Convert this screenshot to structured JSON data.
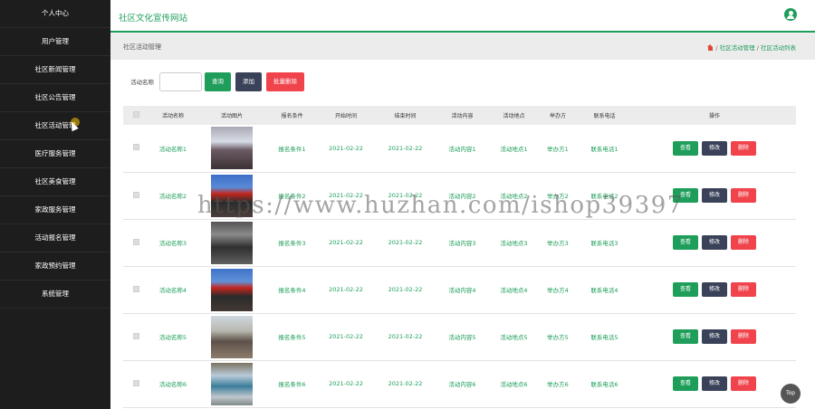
{
  "sidebar": {
    "items": [
      {
        "label": "个人中心"
      },
      {
        "label": "用户管理"
      },
      {
        "label": "社区新闻管理"
      },
      {
        "label": "社区公告管理"
      },
      {
        "label": "社区活动管理"
      },
      {
        "label": "医疗服务管理"
      },
      {
        "label": "社区美食管理"
      },
      {
        "label": "家政服务管理"
      },
      {
        "label": "活动报名管理"
      },
      {
        "label": "家政预约管理"
      },
      {
        "label": "系统管理"
      }
    ]
  },
  "header": {
    "title": "社区文化宣传网站",
    "avatar_icon": "user-icon"
  },
  "breadcrumb": {
    "page_title": "社区活动管理",
    "sep1": "/",
    "item1": "社区活动管理",
    "sep2": "/",
    "item2": "社区活动列表"
  },
  "search": {
    "label": "活动名称",
    "value": "",
    "query_button": "查询",
    "add_button": "添加",
    "batch_delete_button": "批量删除"
  },
  "table": {
    "columns": [
      "活动名称",
      "活动图片",
      "报名条件",
      "开始时间",
      "结束时间",
      "活动内容",
      "活动地点",
      "举办方",
      "联系电话",
      "操作"
    ],
    "rows": [
      {
        "name": "活动名称1",
        "condition": "报名条件1",
        "start": "2021-02-22",
        "end": "2021-02-22",
        "content": "活动内容1",
        "place": "活动地点1",
        "host": "举办方1",
        "phone": "联系电话1"
      },
      {
        "name": "活动名称2",
        "condition": "报名条件2",
        "start": "2021-02-22",
        "end": "2021-02-22",
        "content": "活动内容2",
        "place": "活动地点2",
        "host": "举办方2",
        "phone": "联系电话2"
      },
      {
        "name": "活动名称3",
        "condition": "报名条件3",
        "start": "2021-02-22",
        "end": "2021-02-22",
        "content": "活动内容3",
        "place": "活动地点3",
        "host": "举办方3",
        "phone": "联系电话3"
      },
      {
        "name": "活动名称4",
        "condition": "报名条件4",
        "start": "2021-02-22",
        "end": "2021-02-22",
        "content": "活动内容4",
        "place": "活动地点4",
        "host": "举办方4",
        "phone": "联系电话4"
      },
      {
        "name": "活动名称5",
        "condition": "报名条件5",
        "start": "2021-02-22",
        "end": "2021-02-22",
        "content": "活动内容5",
        "place": "活动地点5",
        "host": "举办方5",
        "phone": "联系电话5"
      },
      {
        "name": "活动名称6",
        "condition": "报名条件6",
        "start": "2021-02-22",
        "end": "2021-02-22",
        "content": "活动内容6",
        "place": "活动地点6",
        "host": "举办方6",
        "phone": "联系电话6"
      }
    ],
    "actions": {
      "view": "查看",
      "edit": "修改",
      "delete": "删除"
    }
  },
  "watermark": "https://www.huzhan.com/ishop39397",
  "top_button": "Top",
  "colors": {
    "accent": "#1e9e5a",
    "danger": "#f0434c",
    "dark": "#3a4259",
    "sidebar": "#1d1d1d"
  }
}
